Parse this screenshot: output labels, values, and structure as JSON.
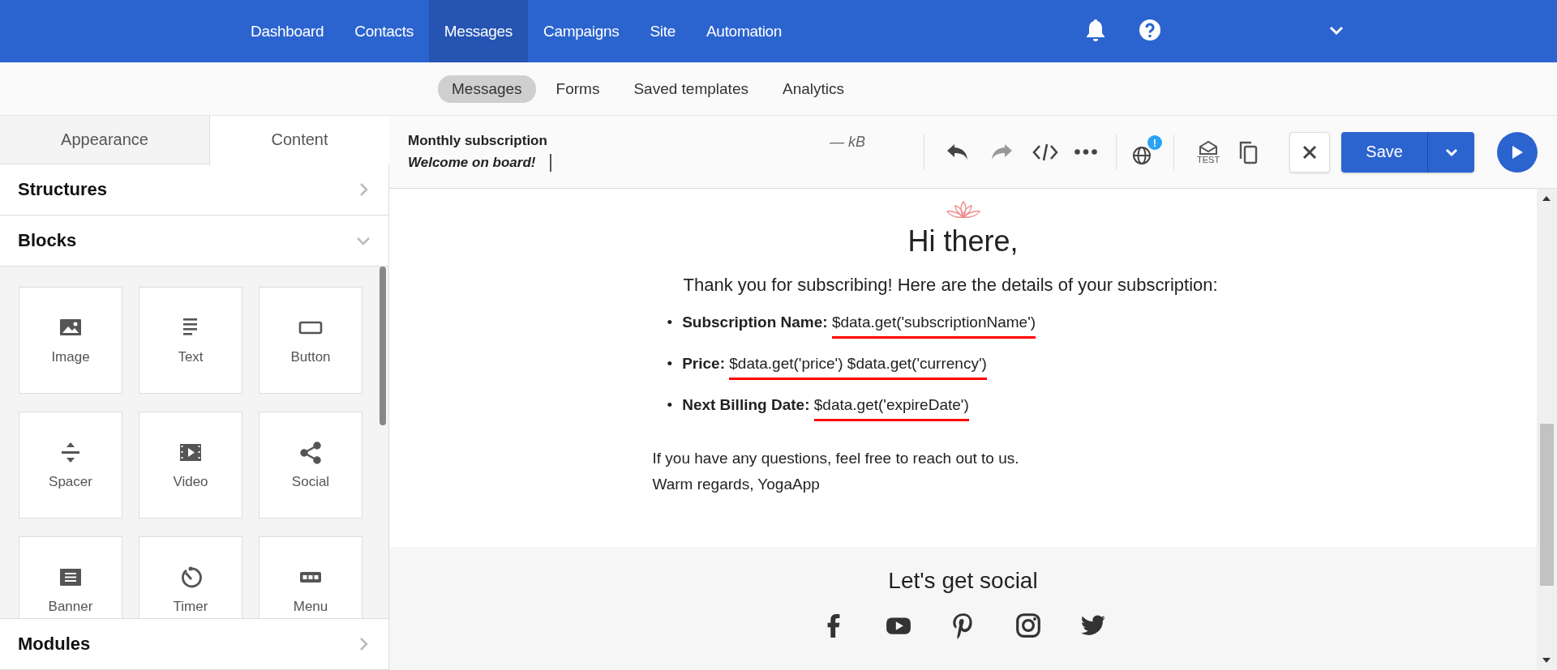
{
  "nav": {
    "items": [
      {
        "label": "Dashboard",
        "selected": false
      },
      {
        "label": "Contacts",
        "selected": false
      },
      {
        "label": "Messages",
        "selected": true
      },
      {
        "label": "Campaigns",
        "selected": false
      },
      {
        "label": "Site",
        "selected": false
      },
      {
        "label": "Automation",
        "selected": false
      }
    ]
  },
  "subnav": {
    "items": [
      {
        "label": "Messages",
        "selected": true
      },
      {
        "label": "Forms",
        "selected": false
      },
      {
        "label": "Saved templates",
        "selected": false
      },
      {
        "label": "Analytics",
        "selected": false
      }
    ]
  },
  "panel": {
    "tabs": [
      {
        "label": "Appearance",
        "selected": false
      },
      {
        "label": "Content",
        "selected": true
      }
    ],
    "sections": [
      {
        "title": "Structures",
        "expanded": false
      },
      {
        "title": "Blocks",
        "expanded": true,
        "blocks": [
          {
            "label": "Image",
            "kind": "image"
          },
          {
            "label": "Text",
            "kind": "text"
          },
          {
            "label": "Button",
            "kind": "button"
          },
          {
            "label": "Spacer",
            "kind": "spacer"
          },
          {
            "label": "Video",
            "kind": "video"
          },
          {
            "label": "Social",
            "kind": "social"
          },
          {
            "label": "Banner",
            "kind": "banner"
          },
          {
            "label": "Timer",
            "kind": "timer"
          },
          {
            "label": "Menu",
            "kind": "menu"
          }
        ]
      },
      {
        "title": "Modules",
        "expanded": false
      }
    ]
  },
  "editor": {
    "title": "Monthly subscription",
    "subject": "Welcome on board!",
    "size": "— kB",
    "tools": [
      {
        "kind": "undo",
        "disabled": false
      },
      {
        "kind": "redo",
        "disabled": true
      },
      {
        "kind": "code",
        "disabled": false
      },
      {
        "kind": "more",
        "disabled": false
      }
    ],
    "language_badge": "!",
    "test_label": "TEST",
    "save_label": "Save"
  },
  "email": {
    "heading": "Hi there,",
    "intro": "Thank you for subscribing! Here are the details of your subscription:",
    "details": [
      {
        "marker": "•",
        "label": "Subscription Name:",
        "value": "$data.get('subscriptionName')",
        "underlined": true
      },
      {
        "marker": "•",
        "label": "Price:",
        "value": "$data.get('price') $data.get('currency')",
        "underlined": true
      },
      {
        "marker": "•",
        "label": "Next Billing Date:",
        "value": "$data.get('expireDate')",
        "underlined": true
      }
    ],
    "closing": [
      "If you have any questions, feel free to reach out to us.",
      "Warm regards, YogaApp"
    ],
    "footer": {
      "title": "Let's get social",
      "networks": [
        {
          "kind": "facebook"
        },
        {
          "kind": "youtube"
        },
        {
          "kind": "pinterest"
        },
        {
          "kind": "instagram"
        },
        {
          "kind": "twitter"
        }
      ]
    }
  }
}
